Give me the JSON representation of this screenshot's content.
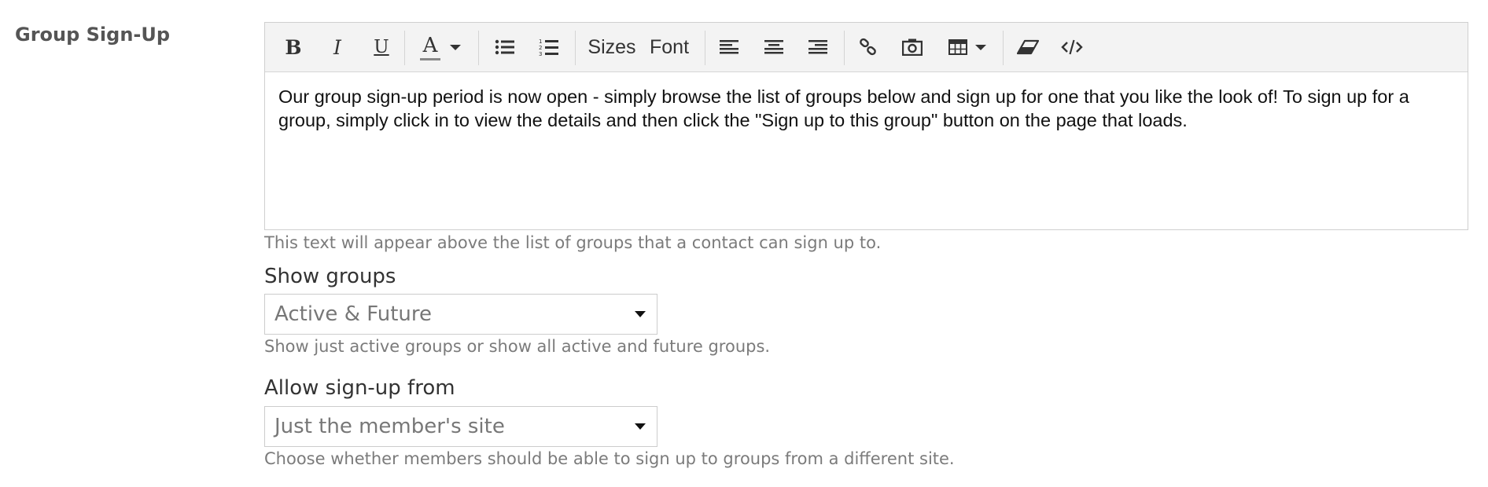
{
  "section": {
    "label": "Group Sign-Up"
  },
  "editor": {
    "toolbar": {
      "bold": "B",
      "italic": "I",
      "underline": "U",
      "font_color": "A",
      "sizes": "Sizes",
      "font": "Font",
      "icons": [
        "bold-icon",
        "italic-icon",
        "underline-icon",
        "font-color-icon",
        "unordered-list-icon",
        "ordered-list-icon",
        "align-left-icon",
        "align-center-icon",
        "align-right-icon",
        "link-icon",
        "picture-icon",
        "table-icon",
        "eraser-icon",
        "code-view-icon"
      ]
    },
    "content": "Our group sign-up period is now open - simply browse the list of groups below and sign up for one that you like the look of! To sign up for a group, simply click in to view the details and then click the \"Sign up to this group\" button on the page that loads.",
    "help": "This text will appear above the list of groups that a contact can sign up to."
  },
  "show_groups": {
    "label": "Show groups",
    "value": "Active & Future",
    "help": "Show just active groups or show all active and future groups."
  },
  "allow_signup": {
    "label": "Allow sign-up from",
    "value": "Just the member's site",
    "help": "Choose whether members should be able to sign up to groups from a different site."
  },
  "colors": {
    "toolbar_bg": "#f3f3f3",
    "border": "#cfcfcf",
    "help_text": "#7b7b7b",
    "label_text": "#555555"
  }
}
